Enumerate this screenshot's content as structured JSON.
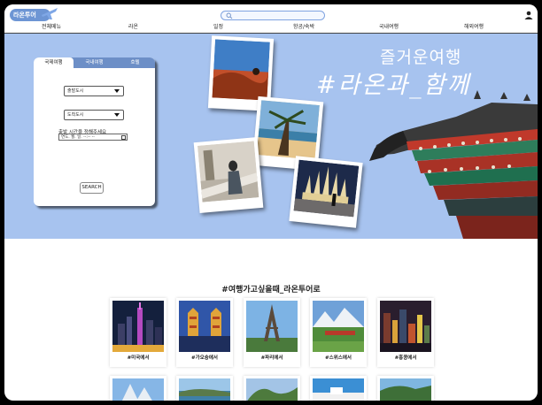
{
  "header": {
    "logo_text": "라온투어",
    "search_placeholder": "",
    "nav": [
      "전체메뉴",
      "라온",
      "일정",
      "항공/숙박",
      "국내여행",
      "해외여행"
    ]
  },
  "hero": {
    "tagline": "즐거운여행",
    "title": "#라온과_함께"
  },
  "booking": {
    "tabs": [
      "국제여행",
      "국내여행",
      "호텔"
    ],
    "active_tab": "국제여행",
    "departure_select": "출발도시",
    "arrival_select": "도착도시",
    "date_label": "출발 시간을 정해주세요",
    "date_value": "연도. 월. 일. --:-- --",
    "search_button": "SEARCH"
  },
  "destinations": {
    "title": "#여행가고싶을때_라온투어로",
    "cards": [
      {
        "label": "#미국에서"
      },
      {
        "label": "#가오슝에서"
      },
      {
        "label": "#파리에서"
      },
      {
        "label": "#스위스에서"
      },
      {
        "label": "#홍콩에서"
      }
    ]
  },
  "colors": {
    "accent": "#6d8fc7",
    "hero_bg": "#a7c3ef",
    "logo_bg": "#6d95d4"
  }
}
